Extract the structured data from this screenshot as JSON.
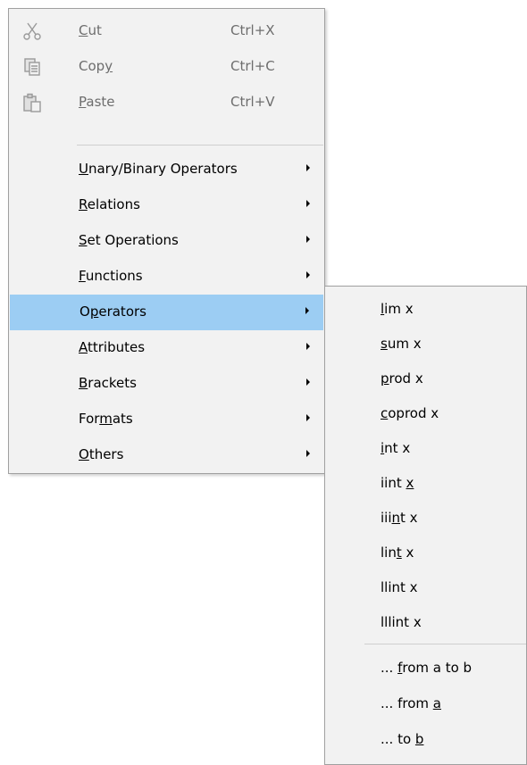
{
  "main_menu": {
    "edit_items": [
      {
        "label": "Cut",
        "mnemonic_index": 0,
        "shortcut": "Ctrl+X",
        "icon": "scissors-icon",
        "enabled": false
      },
      {
        "label": "Copy",
        "mnemonic_index": 3,
        "shortcut": "Ctrl+C",
        "icon": "copy-icon",
        "enabled": false
      },
      {
        "label": "Paste",
        "mnemonic_index": 0,
        "shortcut": "Ctrl+V",
        "icon": "paste-icon",
        "enabled": false
      }
    ],
    "submenu_items": [
      {
        "label": "Unary/Binary Operators",
        "mnemonic_index": 0,
        "highlighted": false
      },
      {
        "label": "Relations",
        "mnemonic_index": 0,
        "highlighted": false
      },
      {
        "label": "Set Operations",
        "mnemonic_index": 0,
        "highlighted": false
      },
      {
        "label": "Functions",
        "mnemonic_index": 0,
        "highlighted": false
      },
      {
        "label": "Operators",
        "mnemonic_index": 1,
        "highlighted": true
      },
      {
        "label": "Attributes",
        "mnemonic_index": 0,
        "highlighted": false
      },
      {
        "label": "Brackets",
        "mnemonic_index": 0,
        "highlighted": false
      },
      {
        "label": "Formats",
        "mnemonic_index": 3,
        "highlighted": false
      },
      {
        "label": "Others",
        "mnemonic_index": 0,
        "highlighted": false
      }
    ]
  },
  "operators_submenu": {
    "items": [
      {
        "label": "lim x",
        "mnemonic_index": 0
      },
      {
        "label": "sum x",
        "mnemonic_index": 0
      },
      {
        "label": "prod x",
        "mnemonic_index": 0
      },
      {
        "label": "coprod x",
        "mnemonic_index": 0
      },
      {
        "label": "int x",
        "mnemonic_index": 0
      },
      {
        "label": "iint x",
        "mnemonic_index": 5
      },
      {
        "label": "iiint x",
        "mnemonic_index": 3
      },
      {
        "label": "lint x",
        "mnemonic_index": 3
      },
      {
        "label": "llint x",
        "mnemonic_index": -1
      },
      {
        "label": "lllint x",
        "mnemonic_index": -1
      }
    ],
    "range_items": [
      {
        "label": "... from a to b",
        "mnemonic_index": 4
      },
      {
        "label": "... from a",
        "mnemonic_index": 9
      },
      {
        "label": "... to b",
        "mnemonic_index": 7
      }
    ]
  },
  "colors": {
    "menu_bg": "#f2f2f2",
    "highlight": "#9ccdf3",
    "disabled_text": "#6d6d6d"
  }
}
